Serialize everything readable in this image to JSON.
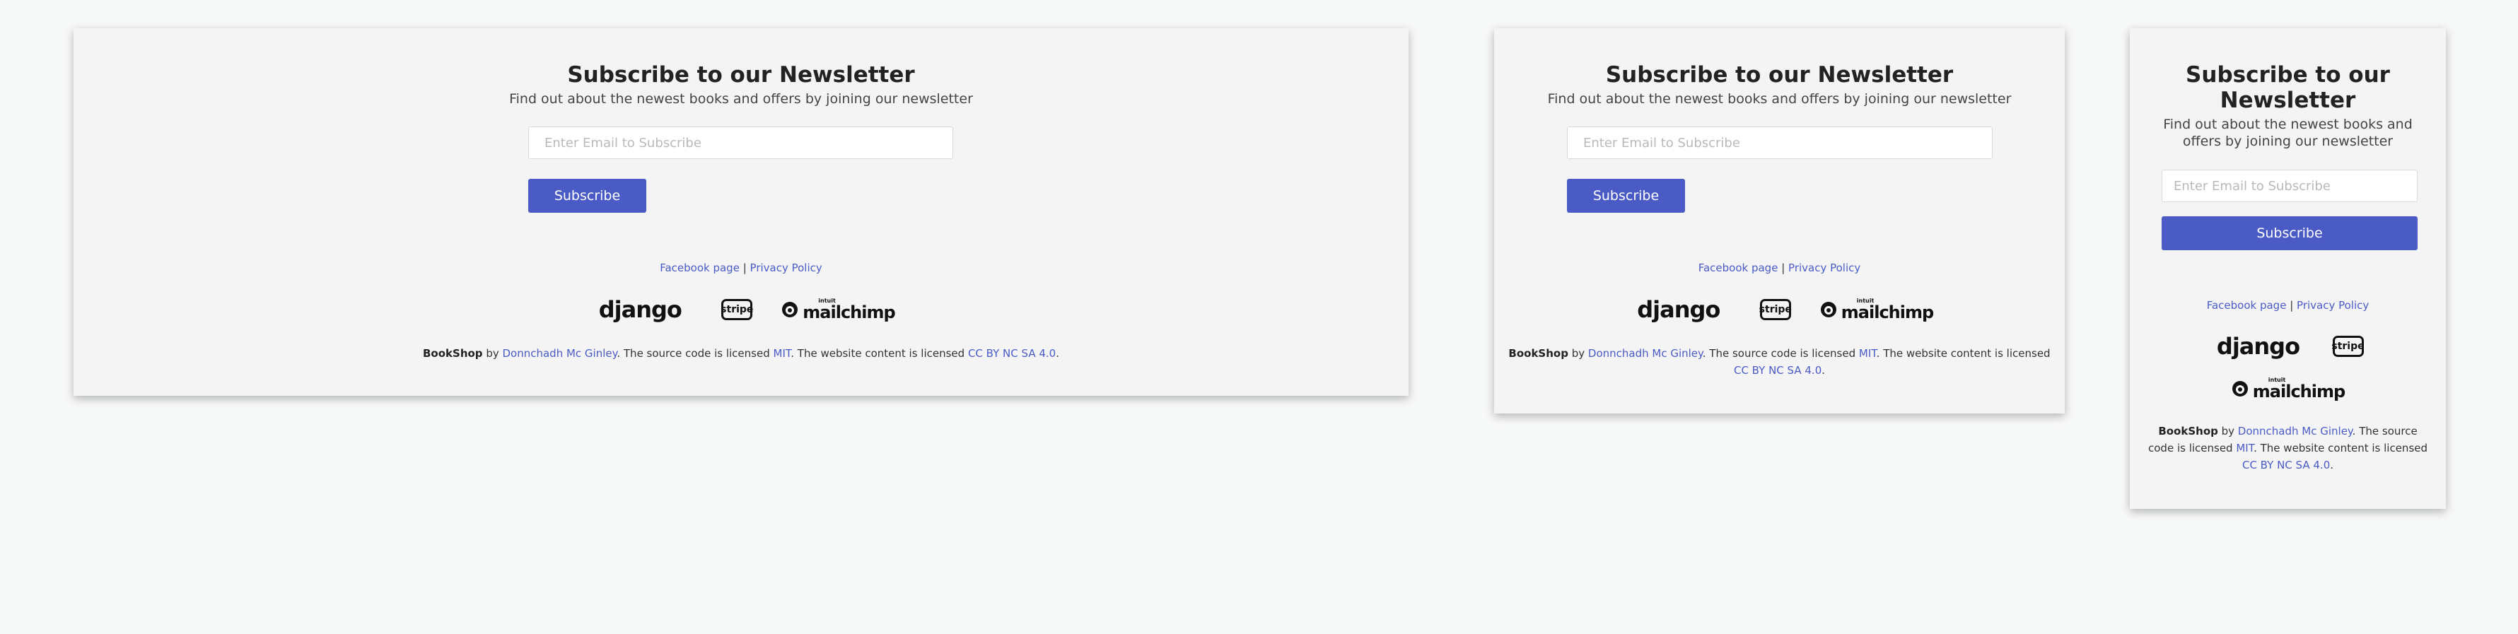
{
  "newsletter": {
    "title": "Subscribe to our Newsletter",
    "subtitle": "Find out about the newest books and offers by joining our newsletter",
    "email_placeholder": "Enter Email to Subscribe",
    "button_label": "Subscribe"
  },
  "footer": {
    "facebook_link": "Facebook page",
    "separator": " | ",
    "privacy_link": "Privacy Policy",
    "logos": {
      "django": "django",
      "stripe": "stripe",
      "mailchimp_small": "intuit",
      "mailchimp": "mailchimp"
    },
    "credit": {
      "brand": "BookShop",
      "by": " by ",
      "author": "Donnchadh Mc Ginley",
      "source_text": ". The source code is licensed ",
      "license_code": "MIT",
      "content_text": ". The website content is licensed ",
      "license_content": "CC BY NC SA 4.0",
      "end": "."
    }
  },
  "colors": {
    "accent": "#4a5bc6",
    "panel": "#f4f4f4",
    "page": "#f7f8f8"
  }
}
